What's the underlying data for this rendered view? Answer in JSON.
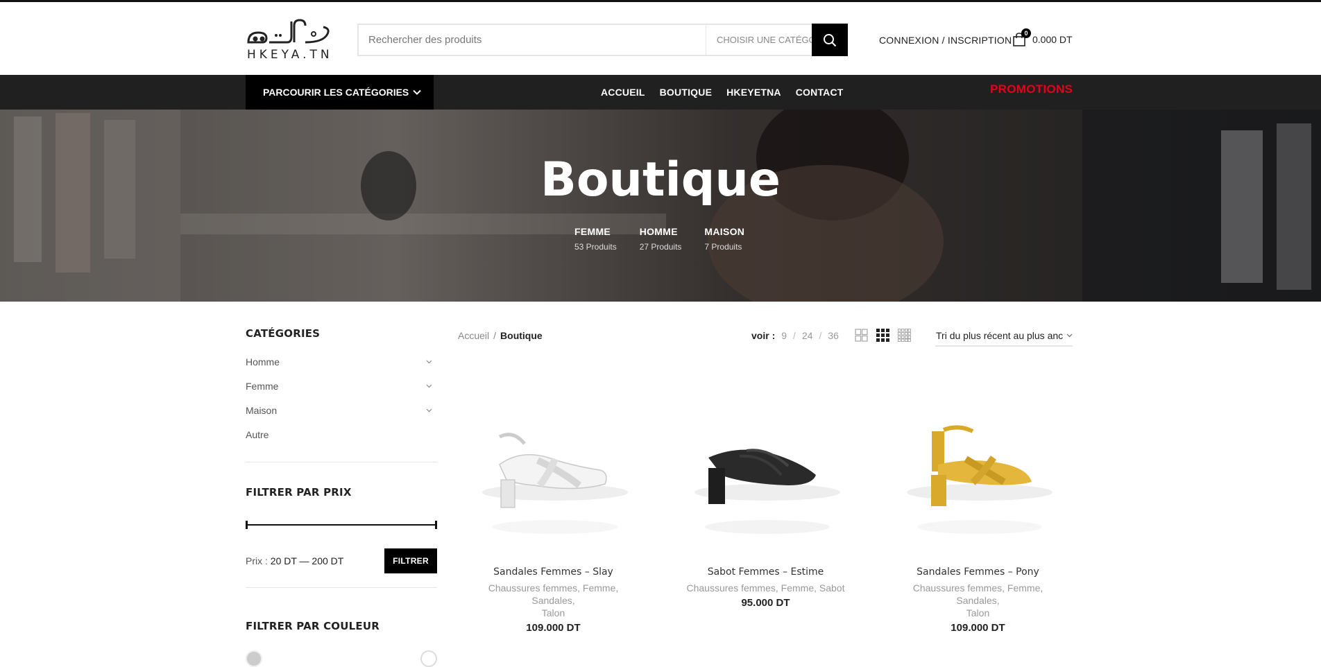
{
  "header": {
    "logo_text": "HKEYA.TN",
    "search_placeholder": "Rechercher des produits",
    "search_category": "CHOISIR UNE CATÉGORIE",
    "account_label": "CONNEXION / INSCRIPTION",
    "cart_count": "0",
    "cart_total": "0.000 DT"
  },
  "nav": {
    "browse_label": "PARCOURIR LES CATÉGORIES",
    "links": [
      "ACCUEIL",
      "BOUTIQUE",
      "HKEYETNA",
      "CONTACT"
    ],
    "promo_label": "PROMOTIONS"
  },
  "hero": {
    "title": "Boutique",
    "categories": [
      {
        "name": "FEMME",
        "count": "53 Produits"
      },
      {
        "name": "HOMME",
        "count": "27 Produits"
      },
      {
        "name": "MAISON",
        "count": "7 Produits"
      }
    ]
  },
  "sidebar": {
    "categories_title": "CATÉGORIES",
    "categories": [
      "Homme",
      "Femme",
      "Maison",
      "Autre"
    ],
    "price_title": "FILTRER PAR PRIX",
    "price_label": "Prix :",
    "price_range": "20 DT — 200 DT",
    "filter_button": "FILTRER",
    "color_title": "FILTRER PAR COULEUR"
  },
  "toolbar": {
    "breadcrumb_home": "Accueil",
    "breadcrumb_sep": "/",
    "breadcrumb_current": "Boutique",
    "voir_label": "voir :",
    "voir_options": [
      "9",
      "24",
      "36"
    ],
    "sort_label": "Tri du plus récent au plus anc"
  },
  "products": [
    {
      "name": "Sandales Femmes – Slay",
      "cats_line1": "Chaussures femmes, Femme, Sandales,",
      "cats_line2": "Talon",
      "price": "109.000 DT",
      "color": "#f2f2f2"
    },
    {
      "name": "Sabot Femmes – Estime",
      "cats_line1": "Chaussures femmes, Femme, Sabot",
      "cats_line2": "",
      "price": "95.000 DT",
      "color": "#222222"
    },
    {
      "name": "Sandales Femmes – Pony",
      "cats_line1": "Chaussures femmes, Femme, Sandales,",
      "cats_line2": "Talon",
      "price": "109.000 DT",
      "color": "#e2b53a"
    }
  ],
  "colors": {
    "accent": "#000000",
    "promo": "#e3001b",
    "nav_bg": "#202020"
  }
}
